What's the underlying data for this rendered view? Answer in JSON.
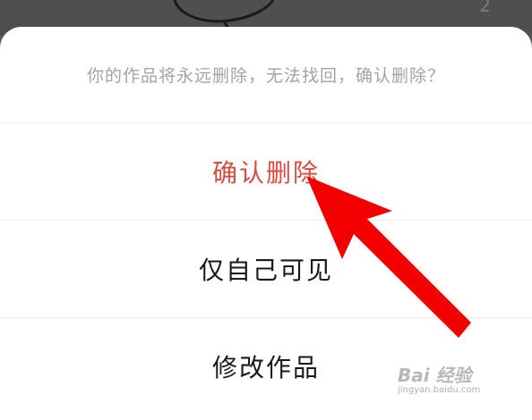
{
  "background": {
    "page_number": "2",
    "color": "#5b5b5b"
  },
  "dialog": {
    "prompt": "你的作品将永远删除，无法找回，确认删除？",
    "options": [
      {
        "label": "确认删除",
        "color": "#d94b3f"
      },
      {
        "label": "仅自己可见",
        "color": "#1a1a1a"
      },
      {
        "label": "修改作品",
        "color": "#1a1a1a"
      }
    ]
  },
  "annotation": {
    "arrow_color": "#f20000",
    "icon": "red-arrow-icon"
  },
  "watermark": {
    "brand": "Bai 经验",
    "url": "jingyan.baidu.com"
  }
}
